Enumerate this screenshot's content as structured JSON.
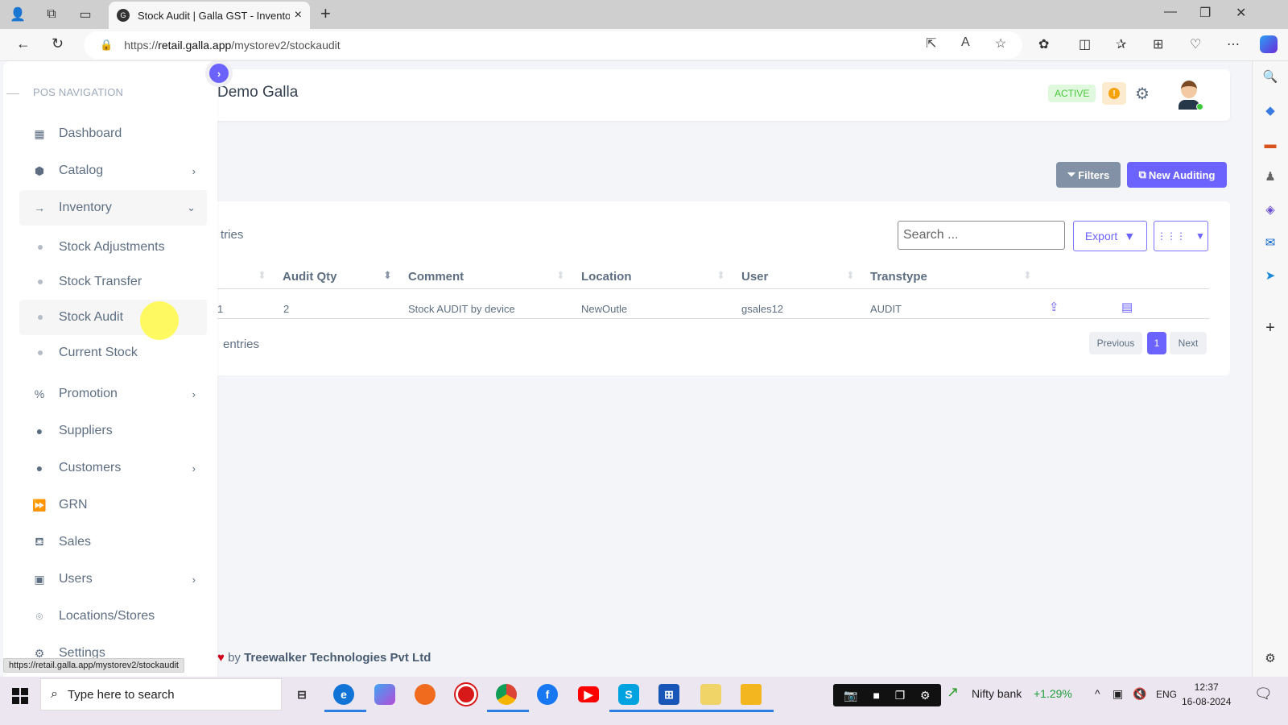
{
  "browser": {
    "tab_title": "Stock Audit | Galla GST - Inventory",
    "url_prefix": "https://",
    "url_domain": "retail.galla.app",
    "url_path": "/mystorev2/stockaudit",
    "status_url": "https://retail.galla.app/mystorev2/stockaudit"
  },
  "header": {
    "brand": "Demo Galla",
    "status_badge": "ACTIVE",
    "warning_glyph": "!"
  },
  "actions": {
    "filters_label": "Filters",
    "new_label": "New Auditing"
  },
  "sidebar": {
    "section_label": "POS NAVIGATION",
    "items": [
      {
        "label": "Dashboard",
        "icon": "dashboard-icon",
        "chevron": ""
      },
      {
        "label": "Catalog",
        "icon": "cube-icon",
        "chevron": "›"
      },
      {
        "label": "Inventory",
        "icon": "arrow-right-icon",
        "chevron": "⌄"
      },
      {
        "label": "Stock Adjustments"
      },
      {
        "label": "Stock Transfer"
      },
      {
        "label": "Stock Audit"
      },
      {
        "label": "Current Stock"
      },
      {
        "label": "Promotion",
        "icon": "percent-tag-icon",
        "chevron": "›"
      },
      {
        "label": "Suppliers",
        "icon": "user-circle-icon",
        "chevron": ""
      },
      {
        "label": "Customers",
        "icon": "user-circle-icon",
        "chevron": "›"
      },
      {
        "label": "GRN",
        "icon": "forward-circle-icon",
        "chevron": ""
      },
      {
        "label": "Sales",
        "icon": "basket-icon",
        "chevron": ""
      },
      {
        "label": "Users",
        "icon": "users-book-icon",
        "chevron": "›"
      },
      {
        "label": "Locations/Stores",
        "icon": "location-pin-icon",
        "chevron": ""
      },
      {
        "label": "Settings",
        "icon": "gear-icon",
        "chevron": ""
      }
    ]
  },
  "table": {
    "show_entries_fragment": "tries",
    "search_placeholder": "Search ...",
    "export_label": "Export",
    "columns": [
      "Audit Qty",
      "Comment",
      "Location",
      "User",
      "Transtype"
    ],
    "rows": [
      {
        "first_fragment": "1",
        "audit_qty": "2",
        "comment": "Stock AUDIT by device",
        "location": "NewOutle",
        "user": "gsales12",
        "transtype": "AUDIT"
      }
    ],
    "entries_fragment": "entries",
    "pagination": {
      "previous": "Previous",
      "current": "1",
      "next": "Next"
    }
  },
  "footer": {
    "by": "by",
    "company": "Treewalker Technologies Pvt Ltd"
  },
  "taskbar": {
    "search_placeholder": "Type here to search",
    "ticker_name": "Nifty bank",
    "ticker_change": "+1.29%",
    "language": "ENG",
    "time": "12:37",
    "date": "16-08-2024"
  },
  "colors": {
    "accent": "#6c63ff",
    "active_badge_bg": "#e0f8dd",
    "active_badge_text": "#4cc73d",
    "warning": "#f5a20d",
    "ticker_up": "#1f9d3a"
  }
}
